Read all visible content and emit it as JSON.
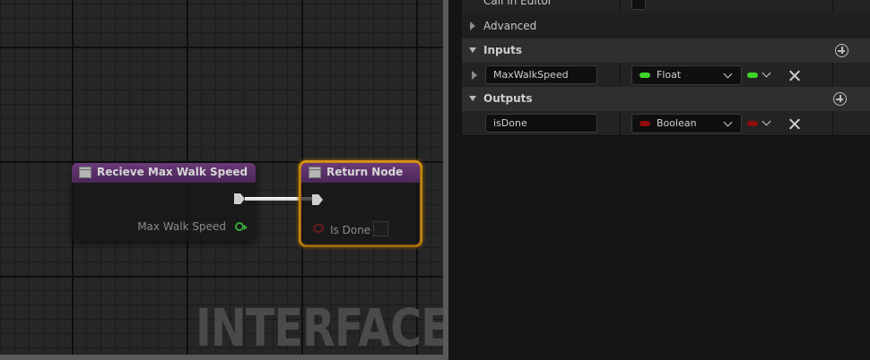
{
  "graph": {
    "watermark": "INTERFACE",
    "nodes": [
      {
        "title": "Recieve Max Walk Speed",
        "output_pin_label": "Max Walk Speed"
      },
      {
        "title": "Return Node",
        "input_pin_label": "Is Done"
      }
    ]
  },
  "details": {
    "call_in_editor": {
      "label": "Call In Editor",
      "checked": false
    },
    "advanced": {
      "label": "Advanced"
    },
    "inputs": {
      "title": "Inputs",
      "params": [
        {
          "name": "MaxWalkSpeed",
          "type": "Float",
          "color": "#3fd62a"
        }
      ]
    },
    "outputs": {
      "title": "Outputs",
      "params": [
        {
          "name": "isDone",
          "type": "Boolean",
          "color": "#8f0d0d"
        }
      ]
    }
  },
  "colors": {
    "selection": "#e39a16",
    "function_header": "#5e3470",
    "exec_wire": "#ffffff"
  }
}
